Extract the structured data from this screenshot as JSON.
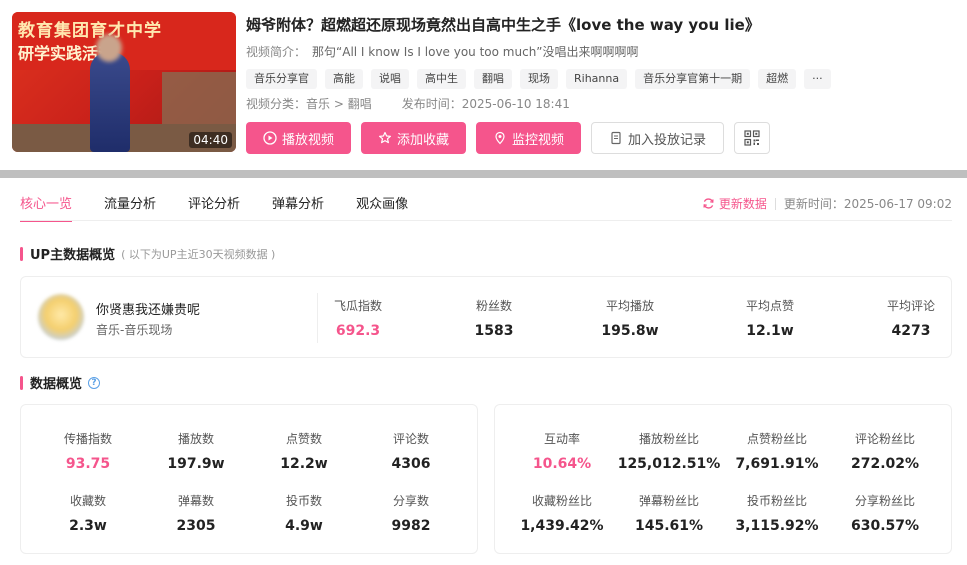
{
  "video": {
    "thumbnail_banner_1": "教育集团育才中学",
    "thumbnail_banner_2": "研学实践活动",
    "duration": "04:40",
    "title": "姆爷附体？超燃超还原现场竟然出自高中生之手《love the way you lie》",
    "desc_label": "视频简介：",
    "desc_value": "那句“All I know Is I love you too much”没唱出来啊啊啊啊",
    "tags": [
      "音乐分享官",
      "高能",
      "说唱",
      "高中生",
      "翻唱",
      "现场",
      "Rihanna",
      "音乐分享官第十一期",
      "超燃",
      "···"
    ],
    "category_label": "视频分类：",
    "category_value": "音乐 > 翻唱",
    "publish_label": "发布时间：",
    "publish_value": "2025-06-10 18:41"
  },
  "buttons": {
    "play": "播放视频",
    "favorite": "添加收藏",
    "monitor": "监控视频",
    "ad_record": "加入投放记录"
  },
  "tabs": [
    "核心一览",
    "流量分析",
    "评论分析",
    "弹幕分析",
    "观众画像"
  ],
  "update": {
    "link": "更新数据",
    "time_label": "更新时间：",
    "time_value": "2025-06-17 09:02"
  },
  "up_section": {
    "title": "UP主数据概览",
    "note": "( 以下为UP主近30天视频数据 )",
    "name": "你贤惠我还嫌贵呢",
    "category": "音乐-音乐现场",
    "stats": [
      {
        "label": "飞瓜指数",
        "value": "692.3",
        "highlight": true
      },
      {
        "label": "粉丝数",
        "value": "1583",
        "highlight": false
      },
      {
        "label": "平均播放",
        "value": "195.8w",
        "highlight": false
      },
      {
        "label": "平均点赞",
        "value": "12.1w",
        "highlight": false
      },
      {
        "label": "平均评论",
        "value": "4273",
        "highlight": false
      }
    ]
  },
  "data_section": {
    "title": "数据概览",
    "help_icon": "question-circle-icon",
    "left": [
      {
        "label": "传播指数",
        "value": "93.75",
        "highlight": true
      },
      {
        "label": "播放数",
        "value": "197.9w",
        "highlight": false
      },
      {
        "label": "点赞数",
        "value": "12.2w",
        "highlight": false
      },
      {
        "label": "评论数",
        "value": "4306",
        "highlight": false
      },
      {
        "label": "收藏数",
        "value": "2.3w",
        "highlight": false
      },
      {
        "label": "弹幕数",
        "value": "2305",
        "highlight": false
      },
      {
        "label": "投币数",
        "value": "4.9w",
        "highlight": false
      },
      {
        "label": "分享数",
        "value": "9982",
        "highlight": false
      }
    ],
    "right": [
      {
        "label": "互动率",
        "value": "10.64%",
        "highlight": true
      },
      {
        "label": "播放粉丝比",
        "value": "125,012.51%",
        "highlight": false
      },
      {
        "label": "点赞粉丝比",
        "value": "7,691.91%",
        "highlight": false
      },
      {
        "label": "评论粉丝比",
        "value": "272.02%",
        "highlight": false
      },
      {
        "label": "收藏粉丝比",
        "value": "1,439.42%",
        "highlight": false
      },
      {
        "label": "弹幕粉丝比",
        "value": "145.61%",
        "highlight": false
      },
      {
        "label": "投币粉丝比",
        "value": "3,115.92%",
        "highlight": false
      },
      {
        "label": "分享粉丝比",
        "value": "630.57%",
        "highlight": false
      }
    ]
  },
  "colors": {
    "accent": "#f5558c",
    "help": "#5aa0e6"
  }
}
